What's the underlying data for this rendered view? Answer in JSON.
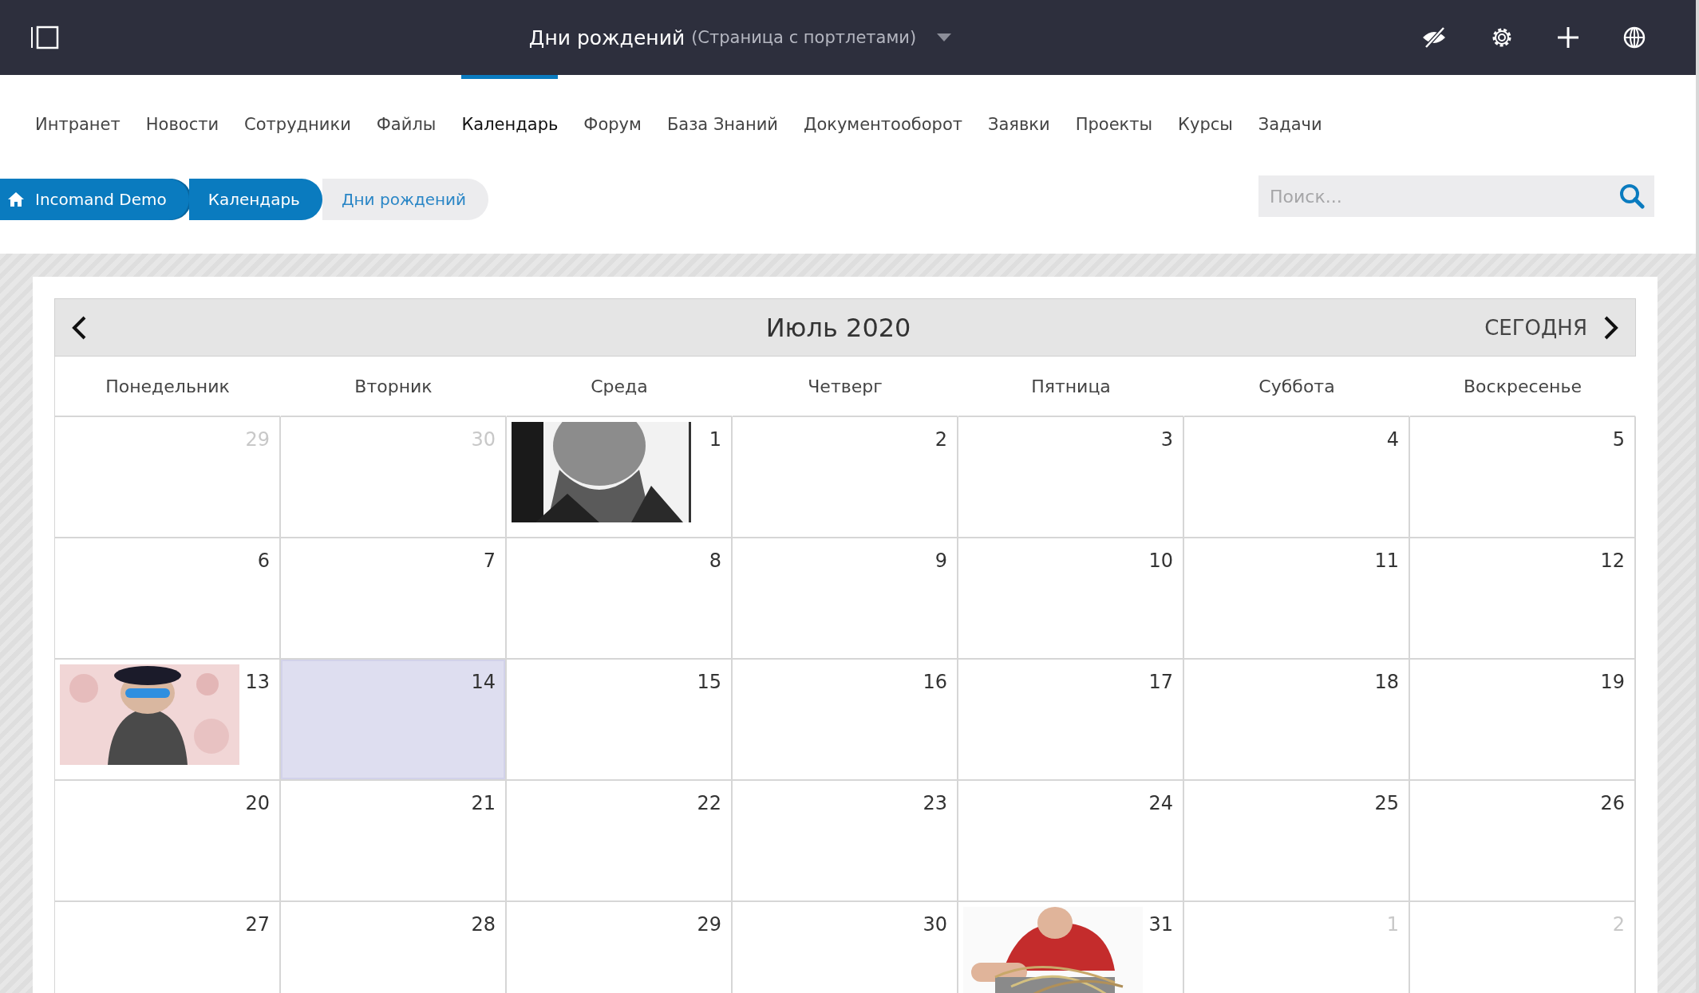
{
  "topbar": {
    "title": "Дни рождений",
    "subtitle": "(Страница с портлетами)"
  },
  "nav": [
    {
      "label": "Интранет",
      "selected": false
    },
    {
      "label": "Новости",
      "selected": false
    },
    {
      "label": "Сотрудники",
      "selected": false
    },
    {
      "label": "Файлы",
      "selected": false
    },
    {
      "label": "Календарь",
      "selected": true
    },
    {
      "label": "Форум",
      "selected": false
    },
    {
      "label": "База Знаний",
      "selected": false
    },
    {
      "label": "Документооборот",
      "selected": false
    },
    {
      "label": "Заявки",
      "selected": false
    },
    {
      "label": "Проекты",
      "selected": false
    },
    {
      "label": "Курсы",
      "selected": false
    },
    {
      "label": "Задачи",
      "selected": false
    }
  ],
  "breadcrumbs": [
    {
      "label": "Incomand Demo",
      "kind": "home"
    },
    {
      "label": "Календарь",
      "kind": "link"
    },
    {
      "label": "Дни рождений",
      "kind": "current"
    }
  ],
  "search": {
    "placeholder": "Поиск..."
  },
  "calendar": {
    "month": "Июль 2020",
    "today_button": "СЕГОДНЯ",
    "weekdays": [
      "Понедельник",
      "Вторник",
      "Среда",
      "Четверг",
      "Пятница",
      "Суббота",
      "Воскресенье"
    ],
    "weeks": [
      [
        {
          "day": "29",
          "muted": true,
          "today": false,
          "kind": "plain"
        },
        {
          "day": "30",
          "muted": true,
          "today": false,
          "kind": "plain"
        },
        {
          "day": "1",
          "muted": false,
          "today": false,
          "kind": "picture"
        },
        {
          "day": "2",
          "muted": false,
          "today": false,
          "kind": "plain"
        },
        {
          "day": "3",
          "muted": false,
          "today": false,
          "kind": "plain"
        },
        {
          "day": "4",
          "muted": false,
          "today": false,
          "kind": "plain"
        },
        {
          "day": "5",
          "muted": false,
          "today": false,
          "kind": "plain"
        }
      ],
      [
        {
          "day": "6",
          "muted": false,
          "today": false,
          "kind": "plain"
        },
        {
          "day": "7",
          "muted": false,
          "today": false,
          "kind": "plain"
        },
        {
          "day": "8",
          "muted": false,
          "today": false,
          "kind": "plain"
        },
        {
          "day": "9",
          "muted": false,
          "today": false,
          "kind": "plain"
        },
        {
          "day": "10",
          "muted": false,
          "today": false,
          "kind": "plain"
        },
        {
          "day": "11",
          "muted": false,
          "today": false,
          "kind": "plain"
        },
        {
          "day": "12",
          "muted": false,
          "today": false,
          "kind": "plain"
        }
      ],
      [
        {
          "day": "13",
          "muted": false,
          "today": false,
          "kind": "picture"
        },
        {
          "day": "14",
          "muted": false,
          "today": true,
          "kind": "plain"
        },
        {
          "day": "15",
          "muted": false,
          "today": false,
          "kind": "plain"
        },
        {
          "day": "16",
          "muted": false,
          "today": false,
          "kind": "plain"
        },
        {
          "day": "17",
          "muted": false,
          "today": false,
          "kind": "plain"
        },
        {
          "day": "18",
          "muted": false,
          "today": false,
          "kind": "plain"
        },
        {
          "day": "19",
          "muted": false,
          "today": false,
          "kind": "plain"
        }
      ],
      [
        {
          "day": "20",
          "muted": false,
          "today": false,
          "kind": "plain"
        },
        {
          "day": "21",
          "muted": false,
          "today": false,
          "kind": "plain"
        },
        {
          "day": "22",
          "muted": false,
          "today": false,
          "kind": "plain"
        },
        {
          "day": "23",
          "muted": false,
          "today": false,
          "kind": "plain"
        },
        {
          "day": "24",
          "muted": false,
          "today": false,
          "kind": "plain"
        },
        {
          "day": "25",
          "muted": false,
          "today": false,
          "kind": "plain"
        },
        {
          "day": "26",
          "muted": false,
          "today": false,
          "kind": "plain"
        }
      ],
      [
        {
          "day": "27",
          "muted": false,
          "today": false,
          "kind": "plain"
        },
        {
          "day": "28",
          "muted": false,
          "today": false,
          "kind": "plain"
        },
        {
          "day": "29",
          "muted": false,
          "today": false,
          "kind": "plain"
        },
        {
          "day": "30",
          "muted": false,
          "today": false,
          "kind": "plain"
        },
        {
          "day": "31",
          "muted": false,
          "today": false,
          "kind": "picture"
        },
        {
          "day": "1",
          "muted": true,
          "today": false,
          "kind": "plain"
        },
        {
          "day": "2",
          "muted": true,
          "today": false,
          "kind": "plain"
        }
      ]
    ]
  }
}
